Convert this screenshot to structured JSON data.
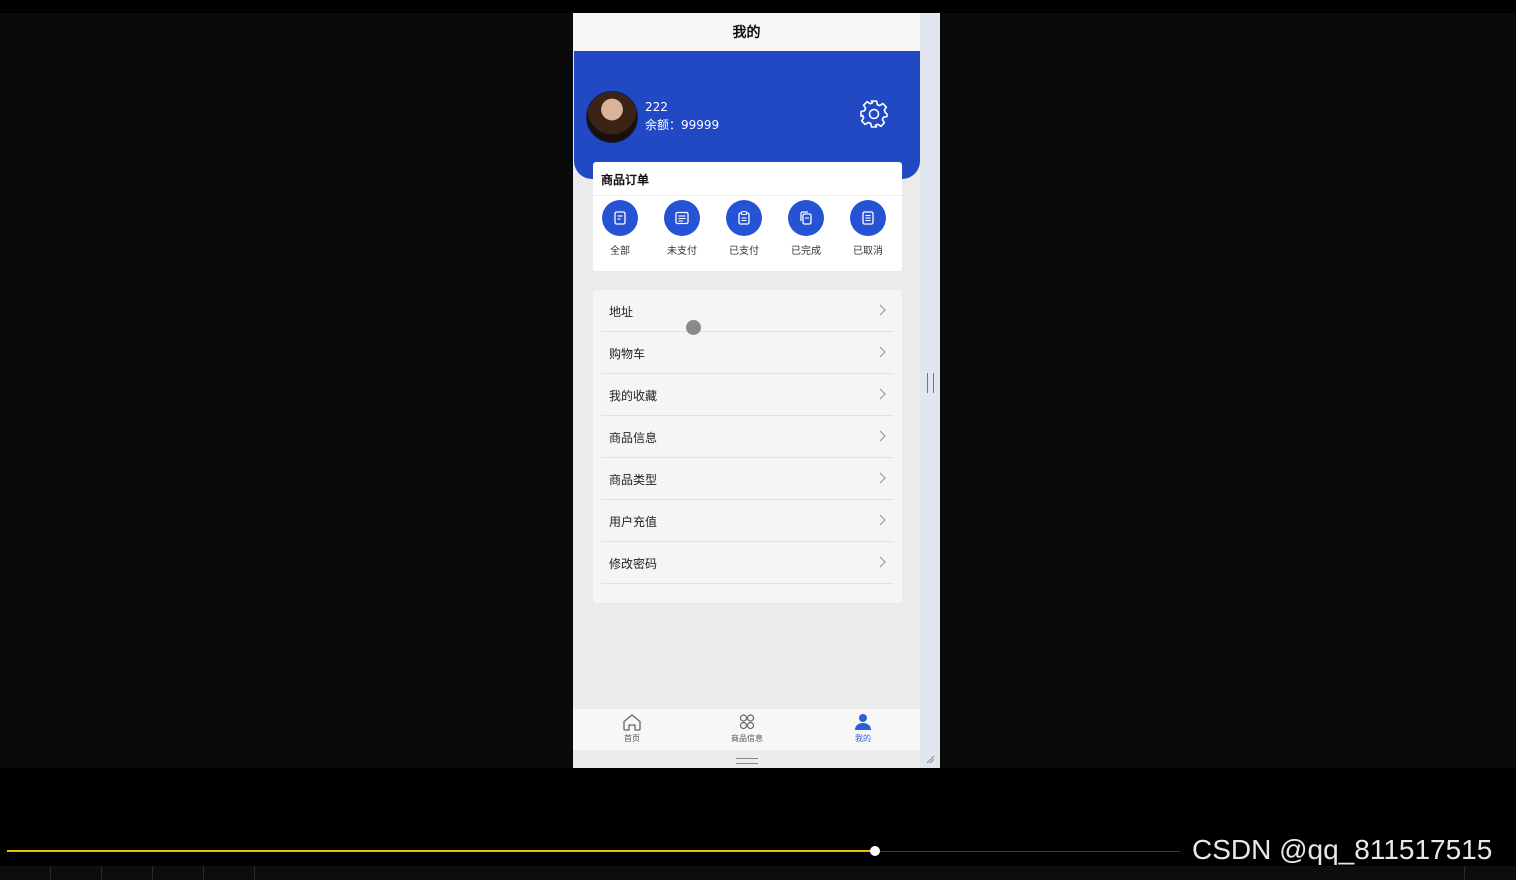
{
  "page": {
    "title": "我的"
  },
  "profile": {
    "username": "222",
    "balance": "余额：99999"
  },
  "orders": {
    "title": "商品订单",
    "items": [
      {
        "label": "全部",
        "icon": "doc-icon"
      },
      {
        "label": "未支付",
        "icon": "list-icon"
      },
      {
        "label": "已支付",
        "icon": "clipboard-icon"
      },
      {
        "label": "已完成",
        "icon": "copy-icon"
      },
      {
        "label": "已取消",
        "icon": "lines-icon"
      }
    ]
  },
  "menu": [
    {
      "label": "地址"
    },
    {
      "label": "购物车"
    },
    {
      "label": "我的收藏"
    },
    {
      "label": "商品信息"
    },
    {
      "label": "商品类型"
    },
    {
      "label": "用户充值"
    },
    {
      "label": "修改密码"
    }
  ],
  "tabbar": {
    "tabs": [
      {
        "label": "首页",
        "icon": "home-icon",
        "active": false
      },
      {
        "label": "商品信息",
        "icon": "grid-icon",
        "active": false
      },
      {
        "label": "我的",
        "icon": "user-icon",
        "active": true
      }
    ]
  },
  "player": {
    "progress": 0.74,
    "watermark": "CSDN @qq_811517515"
  },
  "colors": {
    "header": "#2149c3",
    "accent": "#2652d4",
    "progress": "#e5c200"
  }
}
